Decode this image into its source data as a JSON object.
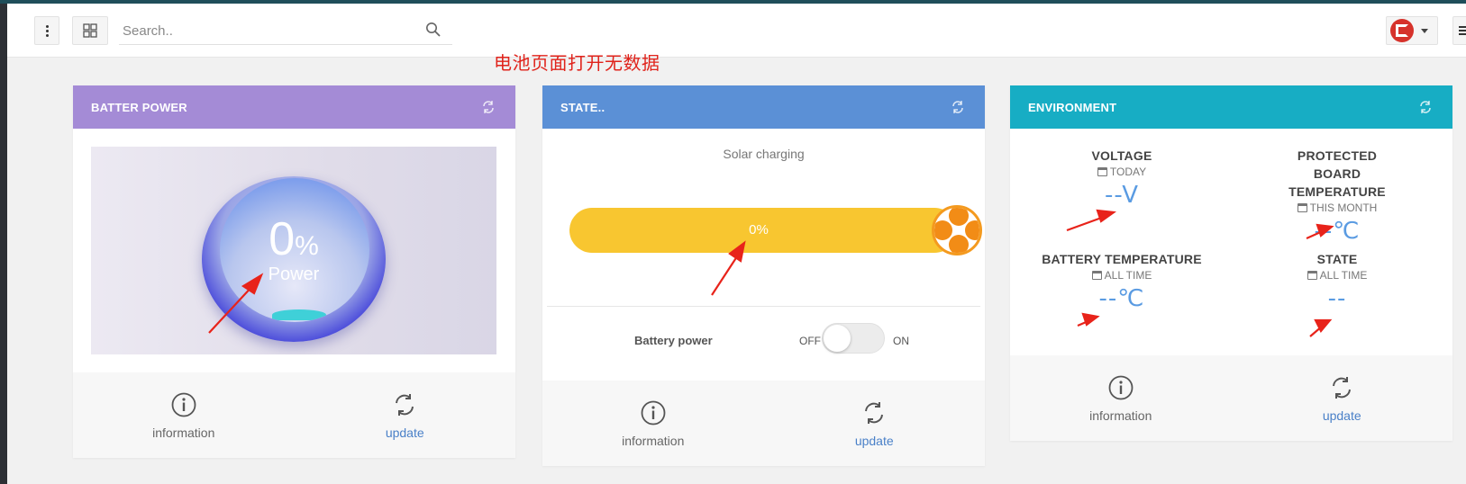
{
  "header": {
    "search_placeholder": "Search..",
    "annotation": "电池页面打开无数据"
  },
  "cards": {
    "battery": {
      "title": "BATTER POWER",
      "gauge_value": "0",
      "gauge_unit": "%",
      "gauge_label": "Power",
      "footer_info": "information",
      "footer_update": "update"
    },
    "state": {
      "title": "STATE..",
      "subtitle": "Solar charging",
      "progress_text": "0%",
      "progress_fraction": 0,
      "toggle_label": "Battery power",
      "toggle_off": "OFF",
      "toggle_on": "ON",
      "toggle_state": "off",
      "footer_info": "information",
      "footer_update": "update"
    },
    "environment": {
      "title": "ENVIRONMENT",
      "metrics": [
        {
          "title": "VOLTAGE",
          "period": "TODAY",
          "value": "--V"
        },
        {
          "title": "PROTECTED BOARD TEMPERATURE",
          "period": "THIS MONTH",
          "value": "--℃"
        },
        {
          "title": "BATTERY TEMPERATURE",
          "period": "ALL TIME",
          "value": "--℃"
        },
        {
          "title": "STATE",
          "period": "ALL TIME",
          "value": "--"
        }
      ],
      "footer_info": "information",
      "footer_update": "update"
    }
  },
  "colors": {
    "battery_header": "#a48bd6",
    "state_header": "#5b90d6",
    "env_header": "#17adc4",
    "progress": "#f8c630",
    "metric_value": "#5a9be2",
    "annotation": "#e0231b",
    "update_link": "#4a80c8"
  }
}
